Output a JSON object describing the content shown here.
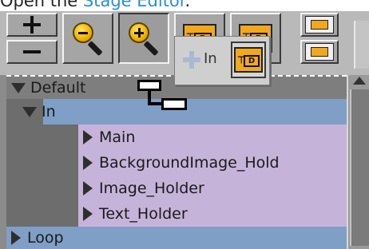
{
  "doc": {
    "prefix": "Open the ",
    "link": "Stage Editor",
    "suffix": "."
  },
  "toolbar": {
    "buttons": [
      {
        "id": "zoom-in-small",
        "icon": "plus-icon"
      },
      {
        "id": "zoom-out-small",
        "icon": "minus-icon"
      },
      {
        "id": "zoom-out",
        "icon": "magnifier-minus-icon"
      },
      {
        "id": "zoom-in",
        "icon": "magnifier-plus-icon"
      },
      {
        "id": "add-director",
        "icon": "director-icon"
      },
      {
        "id": "add-actor",
        "icon": "actor-icon"
      },
      {
        "id": "director-right",
        "icon": "director-right-icon"
      },
      {
        "id": "director-left",
        "icon": "director-left-icon"
      }
    ],
    "td_text": "D",
    "td_t": "┬"
  },
  "popup": {
    "label": "In",
    "td_text": "D"
  },
  "tree": {
    "rows": [
      {
        "label": "Default",
        "expanded": true
      },
      {
        "label": "In",
        "expanded": true
      },
      {
        "label": "Main"
      },
      {
        "label": "BackgroundImage_Hold"
      },
      {
        "label": "Image_Holder"
      },
      {
        "label": "Text_Holder"
      },
      {
        "label": "Loop",
        "expanded": false
      }
    ]
  },
  "colors": {
    "selected_row": "#7f9fc6",
    "child_row": "#c6b3da",
    "accent_orange": "#f2a81d",
    "link": "#2b8dd6"
  }
}
